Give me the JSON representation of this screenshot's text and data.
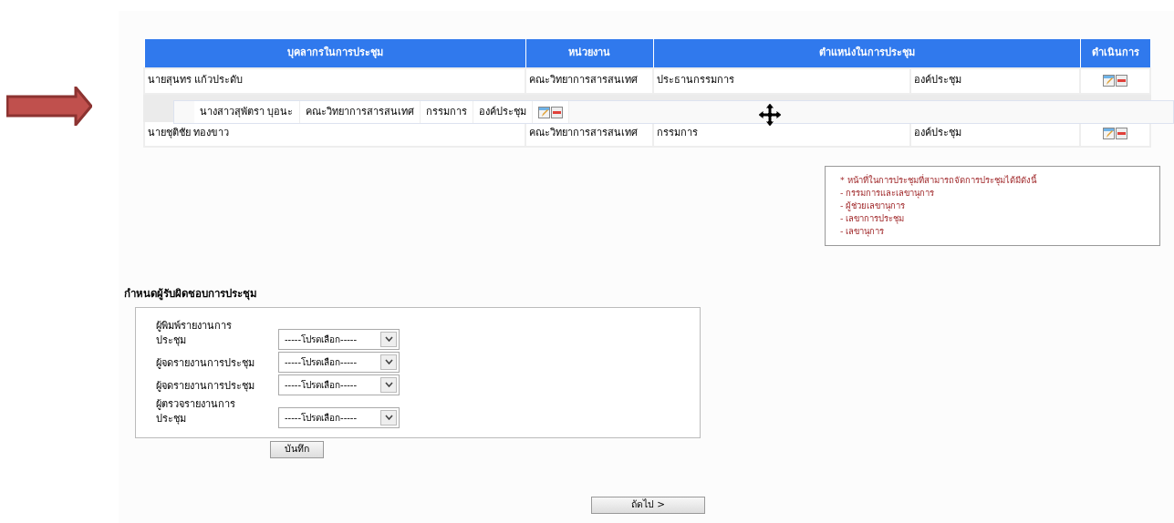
{
  "table": {
    "columns": [
      {
        "label": "บุคลากรในการประชุม"
      },
      {
        "label": "หน่วยงาน"
      },
      {
        "label": "ตำแหน่งในการประชุม"
      },
      {
        "label": "ดำเนินการ"
      }
    ],
    "rows": [
      {
        "kind": "row",
        "name": "นายสุนทร แก้วประดับ",
        "unit": "คณะวิทยาการสารสนเทศ",
        "position": "ประธานกรรมการ",
        "role": "องค์ประชุม"
      },
      {
        "kind": "placeholder"
      },
      {
        "kind": "row",
        "name": "นายชุติชัย ทองขาว",
        "unit": "คณะวิทยาการสารสนเทศ",
        "position": "กรรมการ",
        "role": "องค์ประชุม"
      }
    ],
    "dragged_row": {
      "name": "นางสาวสุพัตรา บุอนะ",
      "unit": "คณะวิทยาการสารสนเทศ",
      "position": "กรรมการ",
      "role": "องค์ประชุม"
    }
  },
  "note": {
    "heading": "* หน้าที่ในการประชุมที่สามารถจัดการประชุมได้มีดังนี้",
    "items": [
      "- กรรมการและเลขานุการ",
      "- ผู้ช่วยเลขานุการ",
      "- เลขาการประชุม",
      "- เลขานุการ"
    ]
  },
  "responsibility": {
    "title": "กำหนดผู้รับผิดชอบการประชุม",
    "fields": [
      {
        "label": "ผู้พิมพ์รายงานการประชุม",
        "value": "-----โปรดเลือก-----"
      },
      {
        "label": "ผู้จดรายงานการประชุม",
        "value": "-----โปรดเลือก-----"
      },
      {
        "label": "ผู้จดรายงานการประชุม",
        "value": "-----โปรดเลือก-----"
      },
      {
        "label": "ผู้ตรวจรายงานการประชุม",
        "value": "-----โปรดเลือก-----"
      }
    ],
    "save_button": "บันทึก"
  },
  "next_button": "ถัดไป >"
}
